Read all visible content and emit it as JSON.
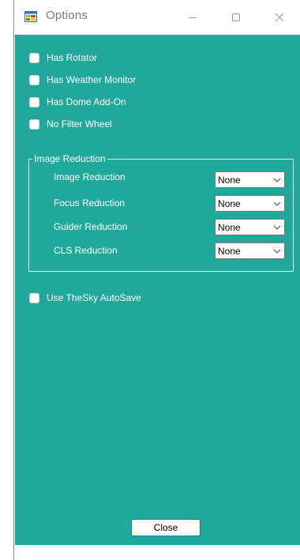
{
  "window": {
    "title": "Options"
  },
  "checkboxes": [
    {
      "label": "Has Rotator",
      "checked": false
    },
    {
      "label": "Has Weather Monitor",
      "checked": false
    },
    {
      "label": "Has Dome Add-On",
      "checked": false
    },
    {
      "label": "No Filter Wheel",
      "checked": false
    }
  ],
  "image_reduction": {
    "group_title": "Image Reduction",
    "rows": [
      {
        "label": "Image Reduction",
        "value": "None"
      },
      {
        "label": "Focus Reduction",
        "value": "None"
      },
      {
        "label": "Guider Reduction",
        "value": "None"
      },
      {
        "label": "CLS Reduction",
        "value": "None"
      }
    ]
  },
  "autosave": {
    "label": "Use TheSky AutoSave",
    "checked": false
  },
  "close_button": {
    "label": "Close"
  },
  "colors": {
    "client_background": "#21a89a",
    "accent": "#0078d4"
  }
}
